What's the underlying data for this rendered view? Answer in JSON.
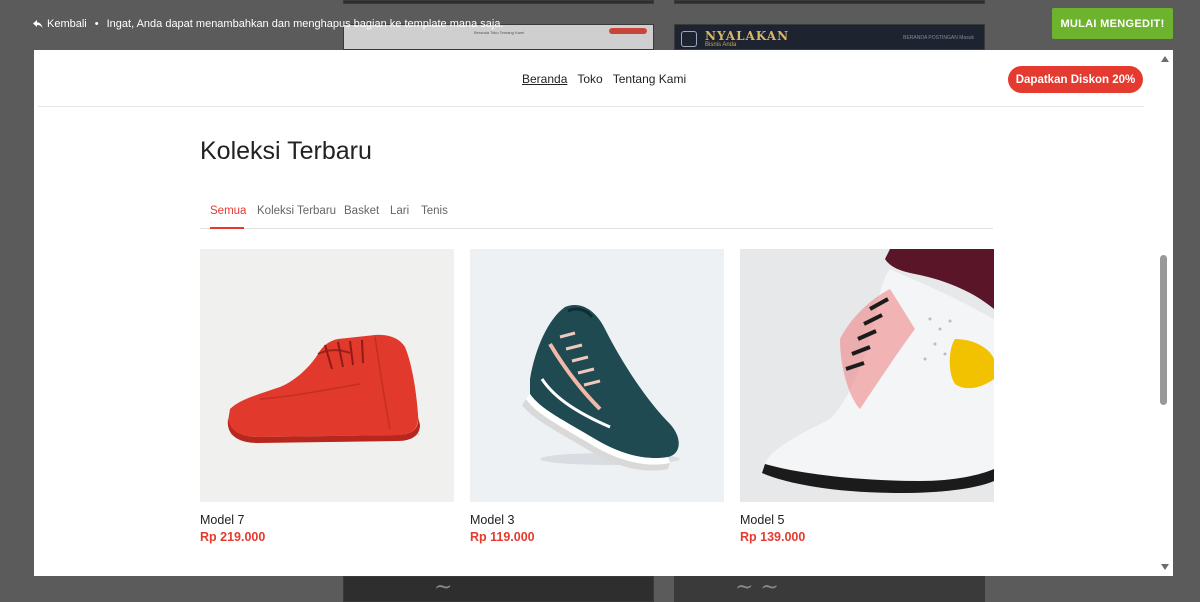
{
  "topbar": {
    "back_label": "Kembali",
    "separator": "•",
    "hint": "Ingat, Anda dapat menambahkan dan menghapus bagian ke template mana saja.",
    "start_label": "MULAI MENGEDIT!"
  },
  "background": {
    "thumb_title": "NYALAKAN",
    "thumb_subtitle": "Bisnis Anda",
    "thumb_nav": "BERANDA  POSTINGAN  Masuk",
    "light_nav": "Beranda  Toko  Tentang Kami"
  },
  "site": {
    "nav": [
      {
        "label": "Beranda",
        "active": true
      },
      {
        "label": "Toko",
        "active": false
      },
      {
        "label": "Tentang Kami",
        "active": false
      }
    ],
    "promo_label": "Dapatkan Diskon 20%"
  },
  "collection": {
    "title": "Koleksi Terbaru",
    "tabs": [
      {
        "label": "Semua",
        "active": true
      },
      {
        "label": "Koleksi Terbaru",
        "active": false
      },
      {
        "label": "Basket",
        "active": false
      },
      {
        "label": "Lari",
        "active": false
      },
      {
        "label": "Tenis",
        "active": false
      }
    ],
    "products": [
      {
        "name": "Model 7",
        "price": "Rp 219.000"
      },
      {
        "name": "Model 3",
        "price": "Rp 119.000"
      },
      {
        "name": "Model 5",
        "price": "Rp 139.000"
      }
    ]
  },
  "colors": {
    "accent": "#e53a2f",
    "start_button": "#6db32d",
    "overlay": "#5b5b5b"
  },
  "icons": {
    "back": "reply-arrow-icon",
    "scroll_up": "triangle-up-icon",
    "scroll_down": "triangle-down-icon"
  }
}
